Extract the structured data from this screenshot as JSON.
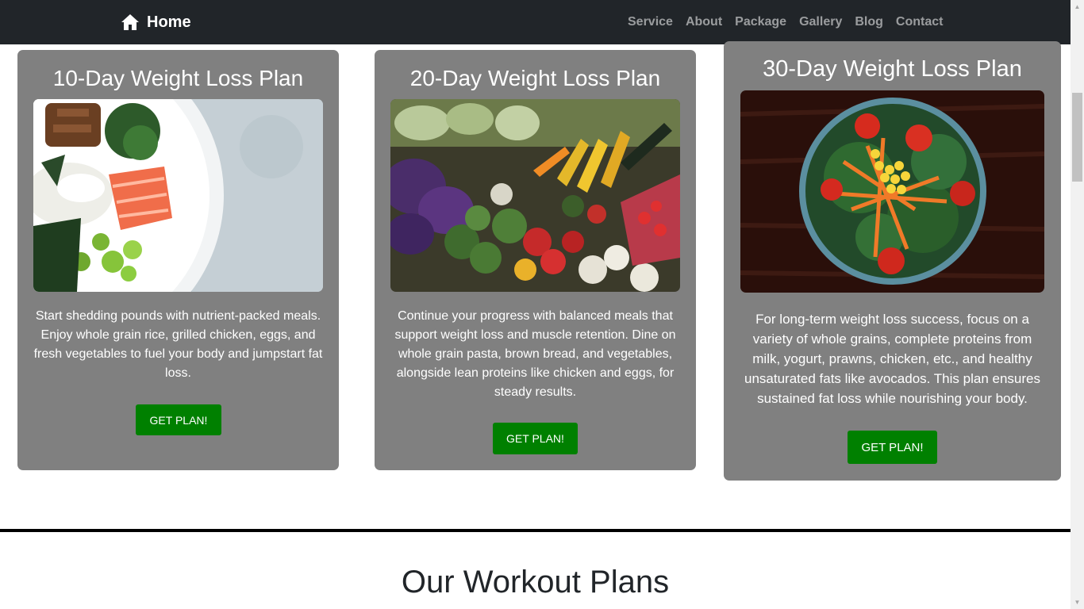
{
  "navbar": {
    "brand": "Home",
    "brand_icon": "home-icon",
    "links": [
      "Service",
      "About",
      "Package",
      "Gallery",
      "Blog",
      "Contact"
    ]
  },
  "plans": [
    {
      "title": "10-Day Weight Loss Plan",
      "image": "salmon-rice-bowl-photo",
      "description": "Start shedding pounds with nutrient-packed meals. Enjoy whole grain rice, grilled chicken, eggs, and fresh vegetables to fuel your body and jumpstart fat loss.",
      "button": "GET PLAN!"
    },
    {
      "title": "20-Day Weight Loss Plan",
      "image": "vegetable-market-photo",
      "description": "Continue your progress with balanced meals that support weight loss and muscle retention. Dine on whole grain pasta, brown bread, and vegetables, alongside lean proteins like chicken and eggs, for steady results.",
      "button": "GET PLAN!"
    },
    {
      "title": "30-Day Weight Loss Plan",
      "image": "salad-bowl-photo",
      "description": "For long-term weight loss success, focus on a variety of whole grains, complete proteins from milk, yogurt, prawns, chicken, etc., and healthy unsaturated fats like avocados. This plan ensures sustained fat loss while nourishing your body.",
      "button": "GET PLAN!"
    }
  ],
  "workout_section": {
    "title": "Our Workout Plans"
  },
  "colors": {
    "navbar": "#212529",
    "card": "#808080",
    "button": "#008000"
  }
}
